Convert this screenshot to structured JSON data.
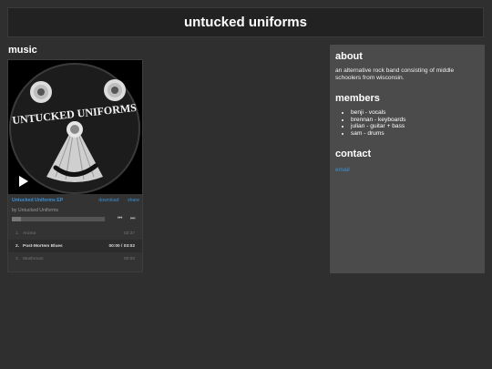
{
  "site": {
    "title": "untucked uniforms"
  },
  "music": {
    "heading": "music",
    "player": {
      "album_art_text": "UNTUCKED UNIFORMS",
      "album_title": "Untucked Uniforms EP",
      "download_label": "download",
      "share_label": "share",
      "by_line": "by Untucked Uniforms",
      "progress": 0.0,
      "tracks": [
        {
          "num": "1.",
          "title": "Aroma",
          "duration": "02:37"
        },
        {
          "num": "2.",
          "title": "Post-Mortem Blues",
          "duration": "00:00 / 03:02"
        },
        {
          "num": "3.",
          "title": "Mushroom",
          "duration": "00:00"
        }
      ]
    }
  },
  "sidebar": {
    "about_heading": "about",
    "about_text": "an alternative rock band consisting of middle schoolers from wisconsin.",
    "members_heading": "members",
    "members": [
      "benji - vocals",
      "brennan - keyboards",
      "julian - guitar + bass",
      "sam - drums"
    ],
    "contact_heading": "contact",
    "email_label": "email"
  },
  "colors": {
    "background": "#2f2f2f",
    "header_bg": "#222222",
    "sidebar_bg": "#4b4b4b",
    "link": "#3a8fd6"
  }
}
